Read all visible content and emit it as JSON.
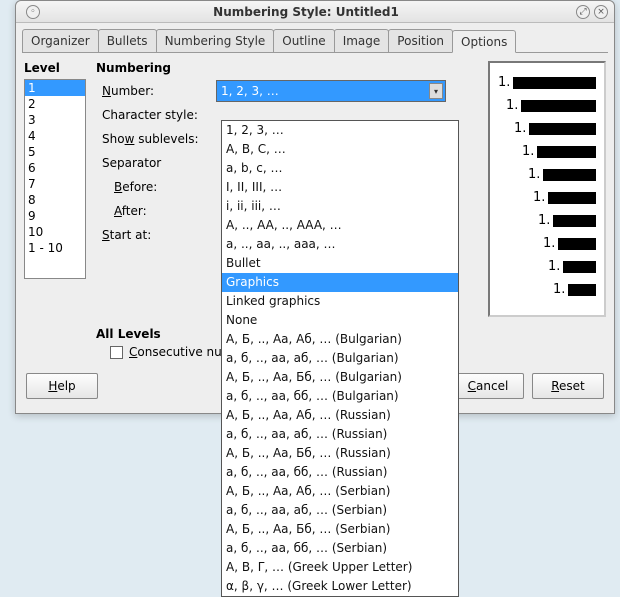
{
  "window": {
    "title": "Numbering Style: Untitled1"
  },
  "tabs": [
    "Organizer",
    "Bullets",
    "Numbering Style",
    "Outline",
    "Image",
    "Position",
    "Options"
  ],
  "active_tab": 6,
  "level": {
    "header": "Level",
    "items": [
      "1",
      "2",
      "3",
      "4",
      "5",
      "6",
      "7",
      "8",
      "9",
      "10",
      "1 - 10"
    ],
    "selected": "1"
  },
  "numbering": {
    "header": "Numbering",
    "number_label": "Number:",
    "number_u": "N",
    "charstyle_label": "Character style:",
    "showsub_label": "Show sublevels:",
    "showsub_u": "w",
    "separator_label": "Separator",
    "before_label": "Before:",
    "before_u": "B",
    "after_label": "After:",
    "after_u": "A",
    "startat_label": "Start at:",
    "startat_u": "S",
    "all_levels": "All Levels",
    "consecutive_label": "Consecutive numbering",
    "consecutive_u": "C",
    "number_value": "1, 2, 3, …"
  },
  "number_options": [
    "1, 2, 3, …",
    "A, B, C, …",
    "a, b, c, …",
    "I, II, III, …",
    "i, ii, iii, …",
    "A, .., AA, .., AAA, …",
    "a, .., aa, .., aaa, …",
    "Bullet",
    "Graphics",
    "Linked graphics",
    "None",
    "А, Б, .., Аа, Аб, … (Bulgarian)",
    "а, б, .., аа, аб, … (Bulgarian)",
    "А, Б, .., Аа, Бб, … (Bulgarian)",
    "а, б, .., аа, бб, … (Bulgarian)",
    "А, Б, .., Аа, Аб, … (Russian)",
    "а, б, .., аа, аб, … (Russian)",
    "А, Б, .., Аа, Бб, … (Russian)",
    "а, б, .., аа, бб, … (Russian)",
    "А, Б, .., Аа, Аб, … (Serbian)",
    "а, б, .., аа, аб, … (Serbian)",
    "А, Б, .., Аа, Бб, … (Serbian)",
    "а, б, .., аа, бб, … (Serbian)",
    "Α, Β, Γ, … (Greek Upper Letter)",
    "α, β, γ, … (Greek Lower Letter)"
  ],
  "number_highlight": 8,
  "preview_label_prefix": "1.",
  "buttons": {
    "help": "Help",
    "help_u": "H",
    "cancel": "Cancel",
    "cancel_u": "C",
    "reset": "Reset",
    "reset_u": "R"
  }
}
